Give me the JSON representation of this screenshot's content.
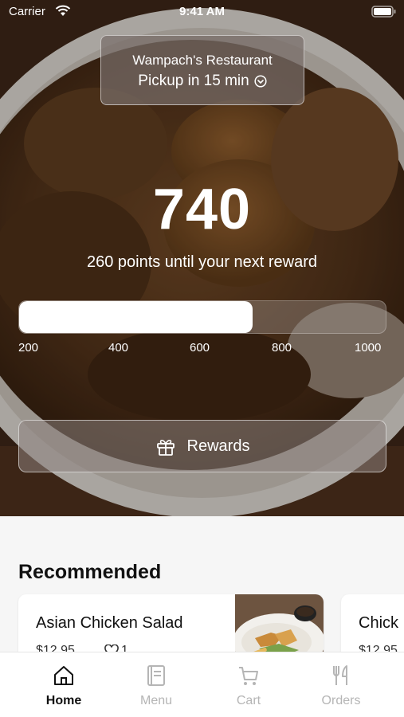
{
  "status_bar": {
    "carrier": "Carrier",
    "time": "9:41 AM"
  },
  "restaurant": {
    "name": "Wampach's Restaurant",
    "pickup": "Pickup in 15 min"
  },
  "rewards": {
    "points": "740",
    "caption": "260 points until your next reward",
    "progress_fraction": 0.637,
    "ticks": [
      "200",
      "400",
      "600",
      "800",
      "1000"
    ],
    "button_label": "Rewards"
  },
  "recommended": {
    "title": "Recommended",
    "items": [
      {
        "name": "Asian Chicken Salad",
        "price": "$12.95",
        "likes": "1"
      },
      {
        "name": "Chick",
        "price": "$12.95"
      }
    ]
  },
  "tabs": [
    {
      "label": "Home",
      "icon": "home-icon",
      "active": true
    },
    {
      "label": "Menu",
      "icon": "menu-book-icon",
      "active": false
    },
    {
      "label": "Cart",
      "icon": "cart-icon",
      "active": false
    },
    {
      "label": "Orders",
      "icon": "fork-knife-icon",
      "active": false
    }
  ],
  "colors": {
    "active_tab": "#111111",
    "inactive_tab": "#b5b5b5",
    "progress_fill": "#ffffff"
  }
}
